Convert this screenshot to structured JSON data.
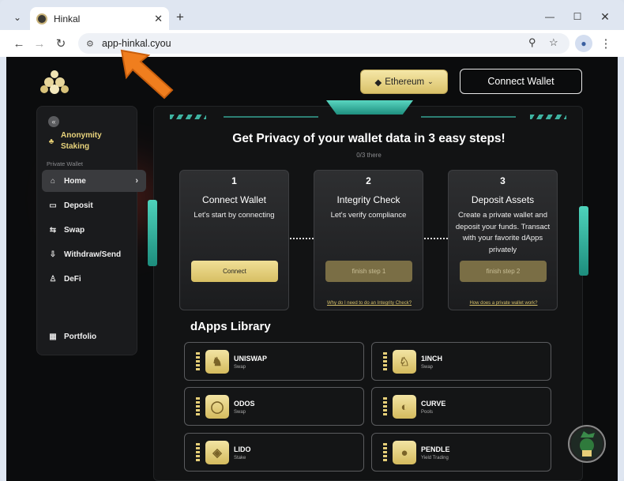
{
  "browser": {
    "tab_title": "Hinkal",
    "url": "app-hinkal.cyou",
    "new_tab": "+",
    "close_tab": "✕"
  },
  "header": {
    "network_label": "Ethereum",
    "connect_label": "Connect Wallet"
  },
  "sidebar": {
    "staking_line1": "Anonymity",
    "staking_line2": "Staking",
    "section_label": "Private Wallet",
    "items": [
      {
        "label": "Home",
        "icon": "home-icon"
      },
      {
        "label": "Deposit",
        "icon": "deposit-icon"
      },
      {
        "label": "Swap",
        "icon": "swap-icon"
      },
      {
        "label": "Withdraw/Send",
        "icon": "withdraw-icon"
      },
      {
        "label": "DeFi",
        "icon": "defi-icon"
      }
    ],
    "portfolio": "Portfolio"
  },
  "main": {
    "heading": "Get Privacy of your wallet data in 3 easy steps!",
    "progress": "0/3 there",
    "steps": [
      {
        "num": "1",
        "title": "Connect Wallet",
        "desc": "Let's start by connecting",
        "button": "Connect",
        "link": ""
      },
      {
        "num": "2",
        "title": "Integrity Check",
        "desc": "Let's verify compliance",
        "button": "finish step 1",
        "link": "Why do I need to do an Integrity Check?"
      },
      {
        "num": "3",
        "title": "Deposit Assets",
        "desc": "Create a private wallet and deposit your funds. Transact with your favorite dApps privately",
        "button": "finish step 2",
        "link": "How does a private wallet work?"
      }
    ],
    "dapps_title": "dApps Library",
    "dapps": [
      {
        "name": "UNISWAP",
        "type": "Swap",
        "icon": "unicorn-icon"
      },
      {
        "name": "1INCH",
        "type": "Swap",
        "icon": "unicorn-head-icon"
      },
      {
        "name": "ODOS",
        "type": "Swap",
        "icon": "ring-icon"
      },
      {
        "name": "CURVE",
        "type": "Pools",
        "icon": "curve-icon"
      },
      {
        "name": "LIDO",
        "type": "Stake",
        "icon": "drop-icon"
      },
      {
        "name": "PENDLE",
        "type": "Yield Trading",
        "icon": "pendle-icon"
      }
    ]
  },
  "colors": {
    "accent": "#e3cc73",
    "teal": "#3fbfa9"
  }
}
